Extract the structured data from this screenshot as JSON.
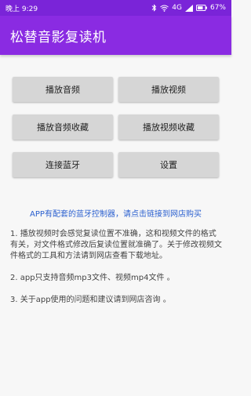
{
  "status_bar": {
    "time": "晚上 9:29",
    "network": "4G",
    "battery": "67%",
    "icons": [
      "bluetooth-icon",
      "wifi-icon",
      "signal-icon",
      "battery-icon"
    ]
  },
  "app_bar": {
    "title": "松替音影复读机",
    "color": "#8a2be2"
  },
  "buttons": {
    "play_audio": "播放音频",
    "play_video": "播放视频",
    "play_audio_favorites": "播放音频收藏",
    "play_video_favorites": "播放视频收藏",
    "connect_bluetooth": "连接蓝牙",
    "settings": "设置"
  },
  "promo_link": {
    "text": "APP有配套的蓝牙控制器，请点击链接到网店购买",
    "color": "#2a5fcf"
  },
  "notes": [
    "1. 播放视频时会感觉复读位置不准确，这和视频文件的格式有关，对文件格式修改后复读位置就准确了。关于修改视频文件格式的工具和方法请到网店查看下载地址。",
    "2. app只支持音频mp3文件、视频mp4文件 。",
    "3. 关于app使用的问题和建议请到网店咨询 。"
  ]
}
